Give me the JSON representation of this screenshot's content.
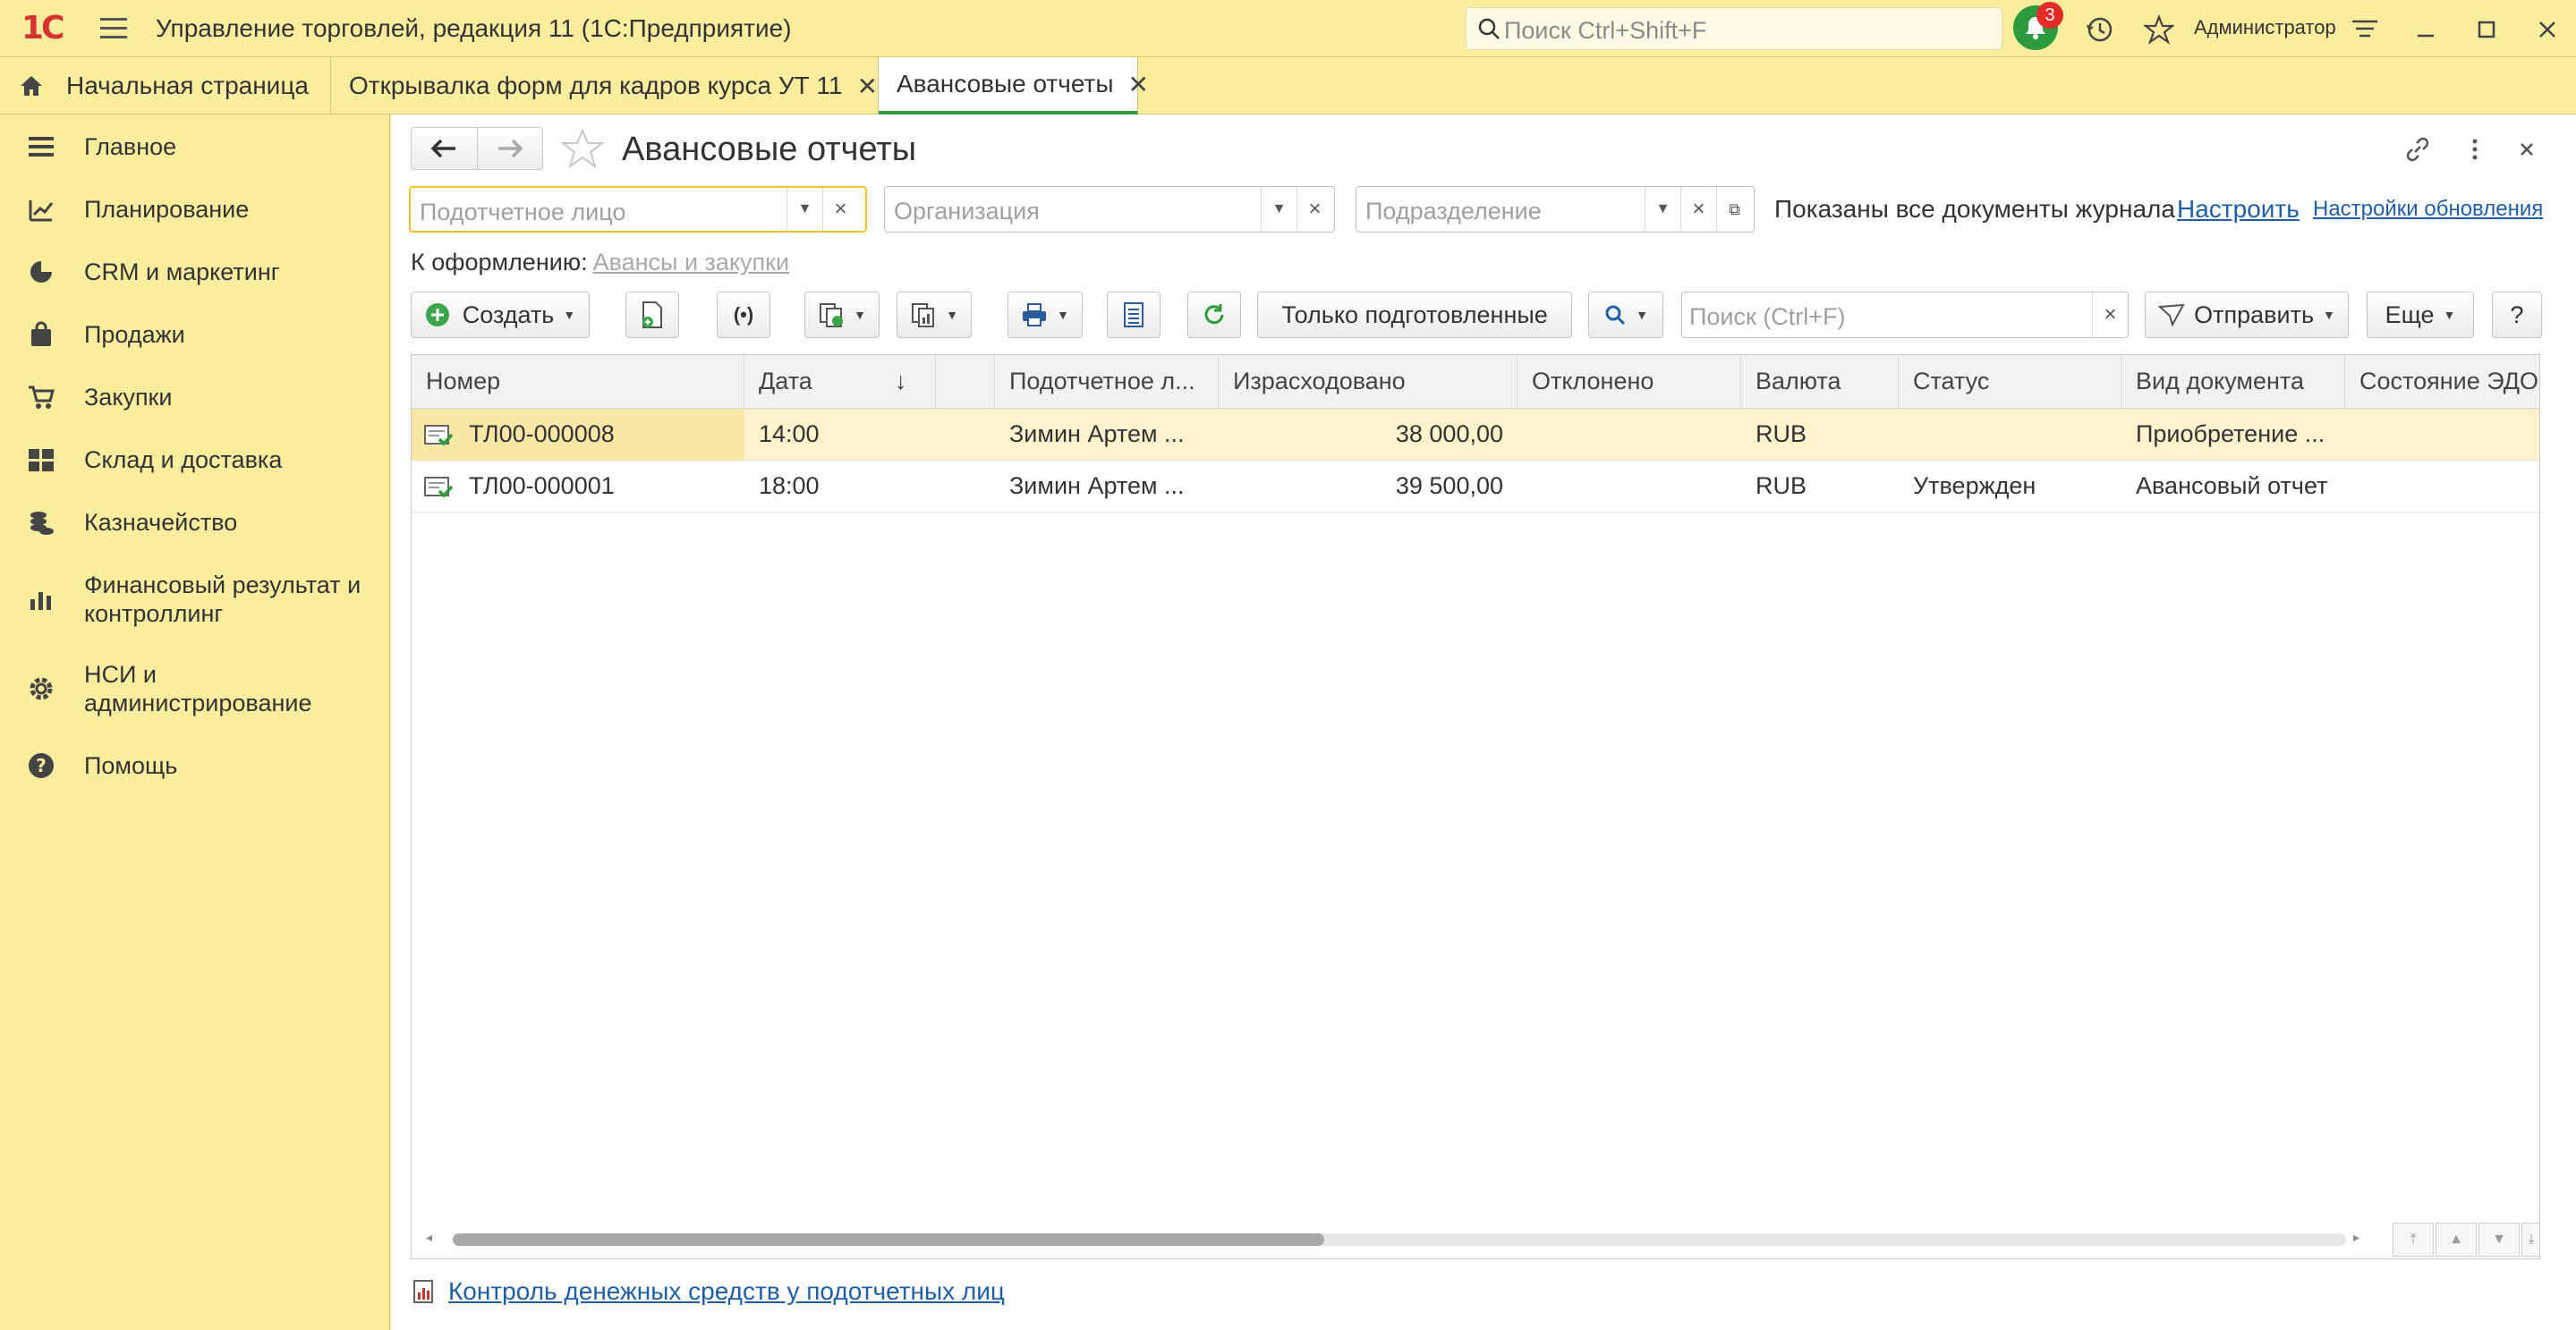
{
  "app": {
    "title": "Управление торговлей, редакция 11  (1С:Предприятие)",
    "search_placeholder": "Поиск Ctrl+Shift+F",
    "notifications_count": "3",
    "user": "Администратор"
  },
  "tabs": [
    {
      "label": "Начальная страница"
    },
    {
      "label": "Открывалка форм для кадров курса УТ 11"
    },
    {
      "label": "Авансовые отчеты"
    }
  ],
  "sidebar": {
    "items": [
      {
        "label": "Главное",
        "icon": "menu-lines-icon"
      },
      {
        "label": "Планирование",
        "icon": "planning-icon"
      },
      {
        "label": "CRM и маркетинг",
        "icon": "pie-chart-icon"
      },
      {
        "label": "Продажи",
        "icon": "shopping-bag-icon"
      },
      {
        "label": "Закупки",
        "icon": "shopping-cart-icon"
      },
      {
        "label": "Склад и доставка",
        "icon": "warehouse-icon"
      },
      {
        "label": "Казначейство",
        "icon": "coins-icon"
      },
      {
        "label": "Финансовый результат и контроллинг",
        "icon": "bar-chart-icon"
      },
      {
        "label": "НСИ и администрирование",
        "icon": "gear-icon"
      },
      {
        "label": "Помощь",
        "icon": "help-icon"
      }
    ]
  },
  "form": {
    "title": "Авансовые отчеты",
    "filters": {
      "person_placeholder": "Подотчетное лицо",
      "org_placeholder": "Организация",
      "dept_placeholder": "Подразделение"
    },
    "shown_text": "Показаны все документы журнала",
    "configure_link": "Настроить",
    "update_settings_link": "Настройки обновления",
    "to_process_label": "К оформлению:",
    "to_process_link": "Авансы и закупки"
  },
  "toolbar": {
    "create": "Создать",
    "only_prepared": "Только подготовленные",
    "search_placeholder": "Поиск (Ctrl+F)",
    "send": "Отправить",
    "more": "Еще",
    "help": "?"
  },
  "table": {
    "columns": [
      "Номер",
      "Дата",
      "Подотчетное л...",
      "Израсходовано",
      "Отклонено",
      "Валюта",
      "Статус",
      "Вид документа",
      "Состояние ЭДО"
    ],
    "sort_indicator": "↓",
    "rows": [
      {
        "number": "ТЛ00-000008",
        "date": "14:00",
        "person": "Зимин Артем ...",
        "spent": "38 000,00",
        "rejected": "",
        "currency": "RUB",
        "status": "",
        "doc_type": "Приобретение ...",
        "edo": ""
      },
      {
        "number": "ТЛ00-000001",
        "date": "18:00",
        "person": "Зимин Артем ...",
        "spent": "39 500,00",
        "rejected": "",
        "currency": "RUB",
        "status": "Утвержден",
        "doc_type": "Авансовый отчет",
        "edo": ""
      }
    ]
  },
  "footer": {
    "report_link": "Контроль денежных средств у подотчетных лиц"
  },
  "colors": {
    "panel_yellow": "#fbed9e",
    "accent_green": "#2f9a42",
    "badge_red": "#e32b27",
    "link_blue": "#1f5fa6",
    "selected_row": "#fdf3cd"
  }
}
